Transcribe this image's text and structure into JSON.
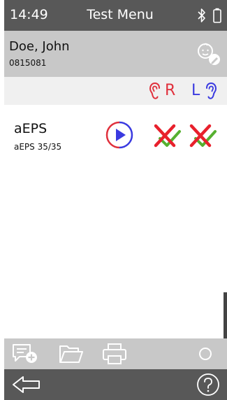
{
  "status_bar": {
    "time": "14:49",
    "title": "Test Menu",
    "icons": [
      "bluetooth-icon",
      "battery-icon"
    ]
  },
  "patient": {
    "name": "Doe, John",
    "id": "0815081",
    "icon": "baby-edit-icon"
  },
  "ears": {
    "right_label": "R",
    "left_label": "L",
    "right_color": "#e0303c",
    "left_color": "#3a3ae0"
  },
  "tests": [
    {
      "name": "aEPS",
      "detail": "aEPS 35/35",
      "action_icon": "play-icon",
      "result_right_icon": "fail-check-icon",
      "result_left_icon": "fail-check-icon"
    }
  ],
  "toolbar": {
    "icons": [
      "add-comment-icon",
      "folder-icon",
      "printer-icon",
      "circle-icon"
    ]
  },
  "nav": {
    "icons": [
      "back-arrow-icon",
      "help-icon"
    ]
  },
  "colors": {
    "header_bg": "#585858",
    "patient_bg": "#c8c8c8",
    "ear_bar_bg": "#f0f0f0",
    "fail_red": "#e8202c",
    "pass_green": "#56b030"
  }
}
